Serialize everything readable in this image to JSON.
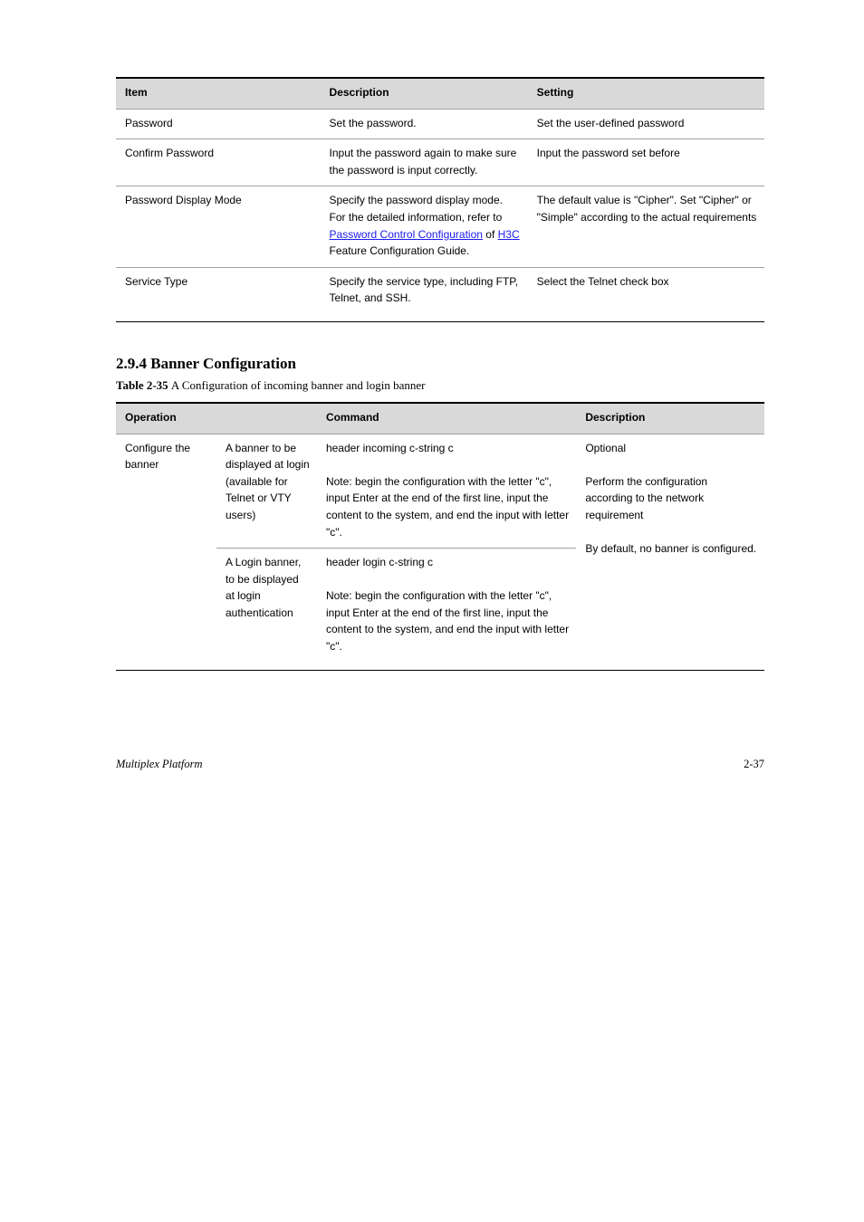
{
  "table1": {
    "headers": [
      "Item",
      "Description",
      "Setting"
    ],
    "rows": [
      {
        "item": "Password",
        "desc": "Set the password.",
        "setting": "Set the user-defined password"
      },
      {
        "item": "Confirm Password",
        "desc": "Input the password again to make sure the password is input correctly.",
        "setting": "Input the password set before"
      },
      {
        "item": "Password Display Mode",
        "desc_pre": "Specify the password display mode. For the detailed information, refer to ",
        "desc_link_text": "Password Control Configuration",
        "desc_link_post": " of ",
        "desc_link2_text": "H3C",
        "desc_post": " Feature Configuration Guide.",
        "setting": "The default value is \"Cipher\". Set \"Cipher\" or \"Simple\" according to the actual requirements"
      },
      {
        "item": "Service Type",
        "desc": "Specify the service type, including FTP, Telnet, and SSH.",
        "setting": "Select the Telnet check box"
      }
    ]
  },
  "section": {
    "heading": "2.9.4  Banner Configuration",
    "caption_label": "Table 2-35 ",
    "caption_text": "A Configuration of incoming banner and login banner"
  },
  "table2": {
    "headers": [
      "Operation",
      "Command",
      "Description"
    ],
    "rows": [
      {
        "op": "Configure the banner",
        "sub1": {
          "label": "A banner to be displayed at login (available for Telnet or VTY users)",
          "cmd": "header incoming c-string c\n\nNote: begin the configuration with the letter \"c\", input Enter at the end of the first line, input the content to the system, and end the input with letter \"c\"."
        },
        "sub2": {
          "label": "A Login banner, to be displayed at login authentication",
          "cmd": "header login c-string c\n\nNote: begin the configuration with the letter \"c\", input Enter at the end of the first line, input the content to the system, and end the input with letter \"c\"."
        },
        "desc": "Optional\n\nPerform the configuration according to the network requirement\n\nBy default, no banner is configured."
      }
    ]
  },
  "footer": {
    "title": "Multiplex Platform",
    "page": "2-37"
  }
}
